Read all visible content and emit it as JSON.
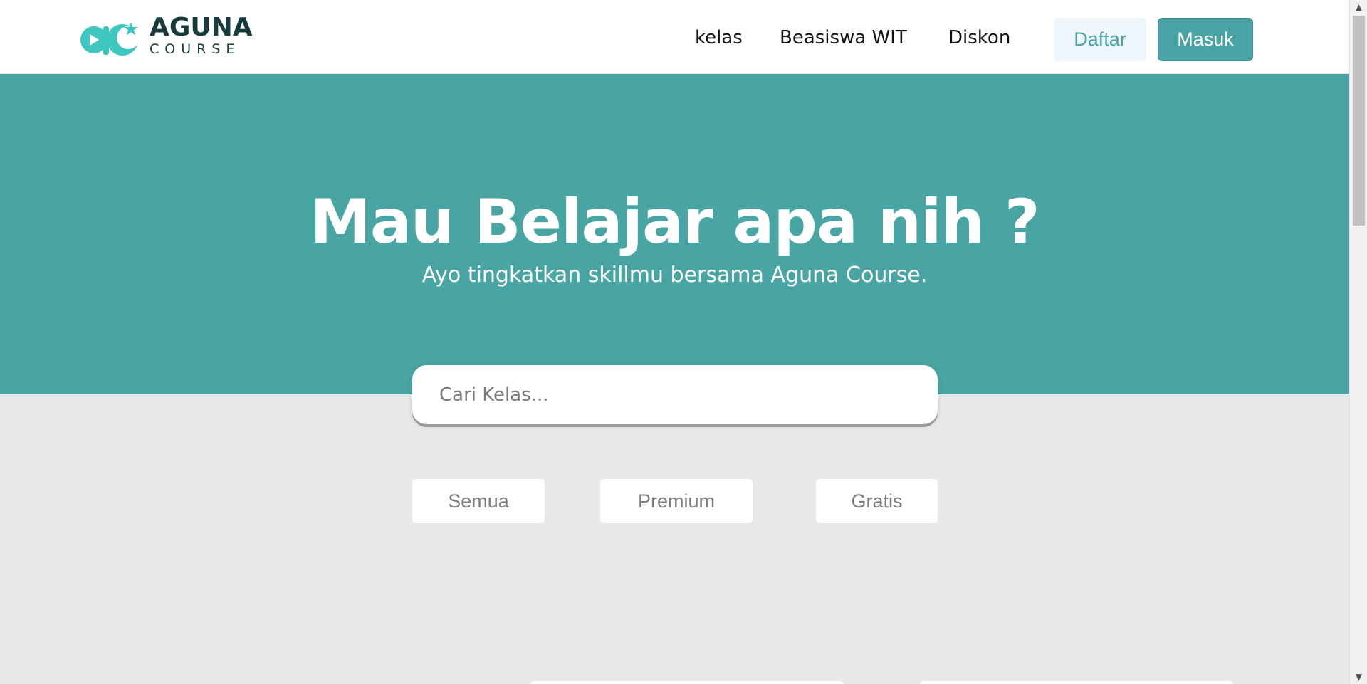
{
  "header": {
    "logo": {
      "brand": "AGUNA",
      "sub": "COURSE"
    },
    "nav": [
      {
        "label": "kelas"
      },
      {
        "label": "Beasiswa WIT"
      },
      {
        "label": "Diskon"
      }
    ],
    "daftar_label": "Daftar",
    "masuk_label": "Masuk"
  },
  "hero": {
    "title": "Mau Belajar apa nih ?",
    "subtitle": "Ayo tingkatkan skillmu bersama Aguna Course."
  },
  "search": {
    "placeholder": "Cari Kelas..."
  },
  "filters": [
    {
      "label": "Semua"
    },
    {
      "label": "Premium"
    },
    {
      "label": "Gratis"
    }
  ],
  "colors": {
    "primary": "#49a4a4",
    "brand_dark": "#173b3c",
    "logo_accent": "#3ec7c0",
    "page_bg": "#e8e8e8",
    "daftar_bg": "#eef6fb"
  },
  "icons": {
    "logo": "aguna-course-logo-icon",
    "scroll_up": "triangle-up-icon",
    "scroll_down": "triangle-down-icon"
  }
}
